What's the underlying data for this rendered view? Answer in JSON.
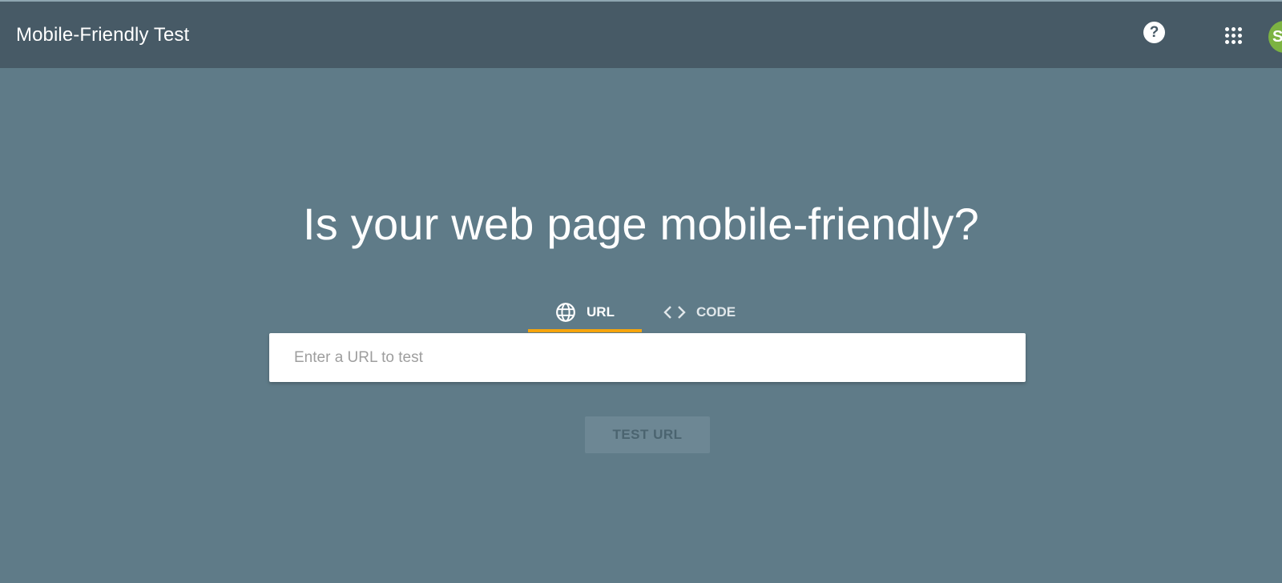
{
  "app": {
    "title": "Mobile-Friendly Test"
  },
  "header": {
    "help_icon": "help-circle-icon",
    "help_glyph": "?",
    "apps_icon": "apps-grid-icon",
    "avatar_initial": "S",
    "avatar_color": "#7cb342"
  },
  "main": {
    "heading": "Is your web page mobile-friendly?",
    "tabs": [
      {
        "label": "URL",
        "icon": "globe-icon",
        "selected": true
      },
      {
        "label": "CODE",
        "icon": "code-icon",
        "selected": false
      }
    ],
    "url_input": {
      "placeholder": "Enter a URL to test",
      "value": ""
    },
    "test_button": {
      "label": "TEST URL",
      "enabled": false
    }
  },
  "colors": {
    "appbar": "#475a66",
    "background": "#5f7b88",
    "tab_indicator": "#f6a50c"
  }
}
